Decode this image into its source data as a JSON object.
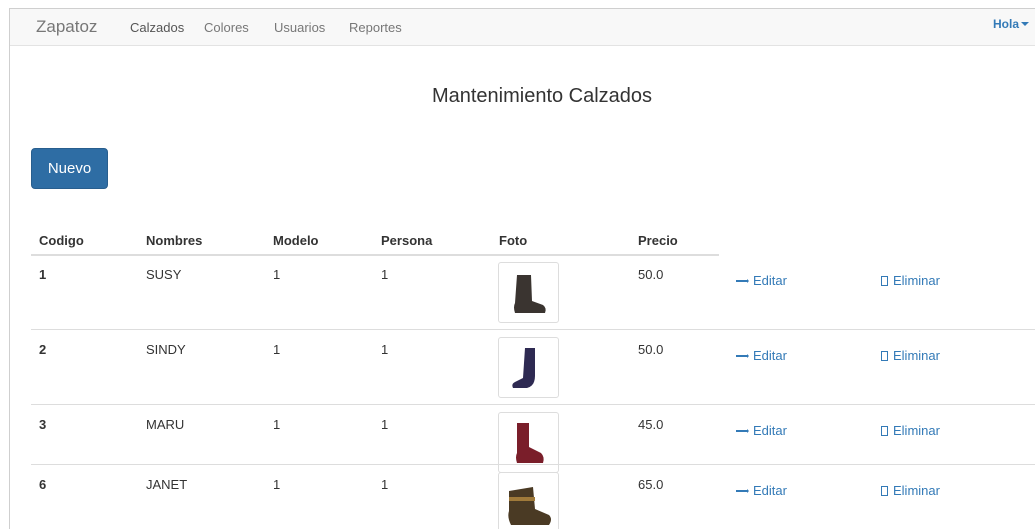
{
  "navbar": {
    "brand": "Zapatoz",
    "links": [
      "Calzados",
      "Colores",
      "Usuarios",
      "Reportes"
    ],
    "user_menu": "Hola"
  },
  "page": {
    "title": "Mantenimiento Calzados",
    "new_button": "Nuevo"
  },
  "table": {
    "headers": [
      "Codigo",
      "Nombres",
      "Modelo",
      "Persona",
      "Foto",
      "Precio"
    ],
    "rows": [
      {
        "codigo": "1",
        "nombre": "SUSY",
        "modelo": "1",
        "persona": "1",
        "precio": "50.0",
        "editar": "Editar",
        "eliminar": "Eliminar",
        "boot_color": "#3a3430"
      },
      {
        "codigo": "2",
        "nombre": "SINDY",
        "modelo": "1",
        "persona": "1",
        "precio": "50.0",
        "editar": "Editar",
        "eliminar": "Eliminar",
        "boot_color": "#2e2a52"
      },
      {
        "codigo": "3",
        "nombre": "MARU",
        "modelo": "1",
        "persona": "1",
        "precio": "45.0",
        "editar": "Editar",
        "eliminar": "Eliminar",
        "boot_color": "#7a1e2a"
      },
      {
        "codigo": "6",
        "nombre": "JANET",
        "modelo": "1",
        "persona": "1",
        "precio": "65.0",
        "editar": "Editar",
        "eliminar": "Eliminar",
        "boot_color": "#4a3a24"
      }
    ]
  },
  "colors": {
    "link": "#337ab7",
    "primary_button": "#2e6da4",
    "navbar_bg": "#f8f8f8"
  }
}
